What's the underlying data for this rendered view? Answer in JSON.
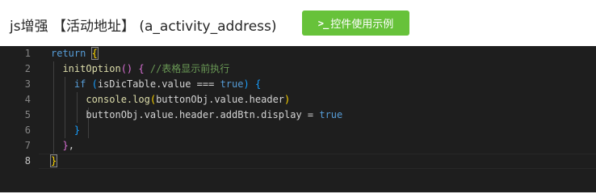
{
  "header": {
    "title": "js增强 【活动地址】 (a_activity_address)",
    "example_button_icon": ">_",
    "example_button_label": "控件使用示例",
    "accent_color": "#67c23a"
  },
  "editor": {
    "line_numbers": [
      "1",
      "2",
      "3",
      "4",
      "5",
      "6",
      "7",
      "8"
    ],
    "active_line": "8",
    "code": {
      "l1": {
        "kw": "return",
        "brace": "{"
      },
      "l2": {
        "fn": "initOption",
        "parens": "()",
        "brace": "{",
        "comment": "//表格显示前执行"
      },
      "l3": {
        "kw_if": "if",
        "open": "(",
        "expr": "isDicTable.value ===",
        "true": "true",
        "close": ")",
        "brace": "{"
      },
      "l4": {
        "fn": "console.log",
        "open": "(",
        "arg": "buttonObj.value.header",
        "close": ")"
      },
      "l5": {
        "expr": "buttonObj.value.header.addBtn.display =",
        "true": "true"
      },
      "l6": {
        "brace": "}"
      },
      "l7": {
        "brace": "}",
        "comma": ","
      },
      "l8": {
        "brace": "}"
      }
    }
  }
}
